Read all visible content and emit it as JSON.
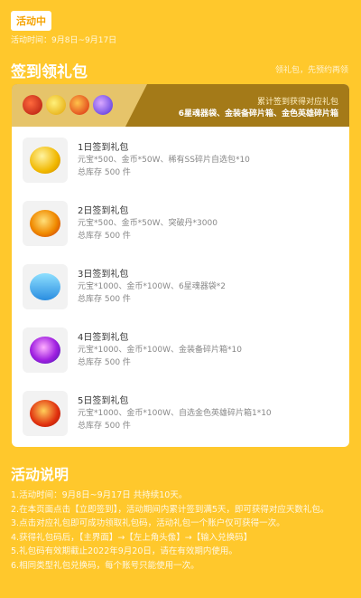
{
  "header": {
    "status_badge": "活动中",
    "event_time": "活动时间：9月8日~9月17日"
  },
  "signin": {
    "title": "签到领礼包",
    "claim_hint": "领礼包，先预约再领",
    "banner": {
      "line1": "累计签到获得对应礼包",
      "line2": "6星魂器袋、金装备碎片箱、金色英雄碎片箱",
      "icons": [
        "gift-red-icon",
        "trophy-icon",
        "chest-icon",
        "exp-orb-icon"
      ]
    },
    "items": [
      {
        "name": "1日签到礼包",
        "desc": "元宝*500、金币*50W、稀有SS碎片自选包*10",
        "stock": "总库存 500 件",
        "icon": "gold-ingot-icon"
      },
      {
        "name": "2日签到礼包",
        "desc": "元宝*500、金币*50W、突破丹*3000",
        "stock": "总库存 500 件",
        "icon": "helmet-icon"
      },
      {
        "name": "3日签到礼包",
        "desc": "元宝*1000、金币*100W、6星魂器袋*2",
        "stock": "总库存 500 件",
        "icon": "treasure-chest-icon"
      },
      {
        "name": "4日签到礼包",
        "desc": "元宝*1000、金币*100W、金装备碎片箱*10",
        "stock": "总库存 500 件",
        "icon": "exp-orb-icon"
      },
      {
        "name": "5日签到礼包",
        "desc": "元宝*1000、金币*100W、自选金色英雄碎片箱1*10",
        "stock": "总库存 500 件",
        "icon": "red-gift-bag-icon"
      }
    ]
  },
  "rules": {
    "title": "活动说明",
    "lines": [
      "1.活动时间：9月8日~9月17日 共持续10天。",
      "2.在本页面点击【立即签到】，活动期间内累计签到满5天，即可获得对应天数礼包。",
      "3.点击对应礼包即可成功领取礼包码，活动礼包一个账户仅可获得一次。",
      "4.获得礼包码后，【主界面】→【左上角头像】→【输入兑换码】",
      "5.礼包码有效期截止2022年9月20日，请在有效期内使用。",
      "6.相同类型礼包兑换码，每个账号只能使用一次。"
    ]
  }
}
